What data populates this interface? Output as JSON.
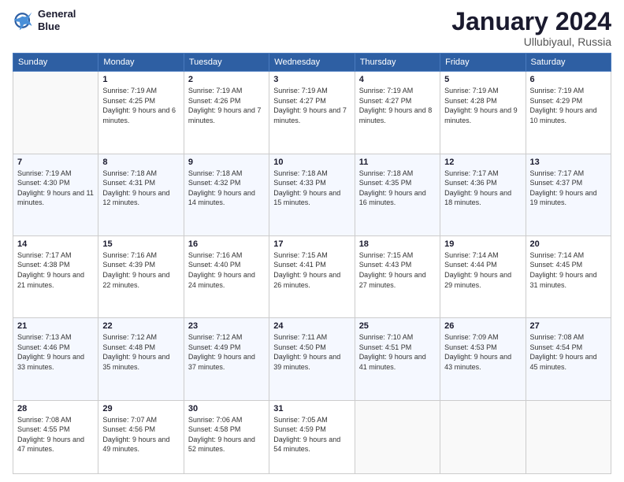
{
  "logo": {
    "line1": "General",
    "line2": "Blue"
  },
  "title": "January 2024",
  "location": "Ullubiyaul, Russia",
  "weekdays": [
    "Sunday",
    "Monday",
    "Tuesday",
    "Wednesday",
    "Thursday",
    "Friday",
    "Saturday"
  ],
  "weeks": [
    [
      {
        "day": "",
        "sunrise": "",
        "sunset": "",
        "daylight": ""
      },
      {
        "day": "1",
        "sunrise": "Sunrise: 7:19 AM",
        "sunset": "Sunset: 4:25 PM",
        "daylight": "Daylight: 9 hours and 6 minutes."
      },
      {
        "day": "2",
        "sunrise": "Sunrise: 7:19 AM",
        "sunset": "Sunset: 4:26 PM",
        "daylight": "Daylight: 9 hours and 7 minutes."
      },
      {
        "day": "3",
        "sunrise": "Sunrise: 7:19 AM",
        "sunset": "Sunset: 4:27 PM",
        "daylight": "Daylight: 9 hours and 7 minutes."
      },
      {
        "day": "4",
        "sunrise": "Sunrise: 7:19 AM",
        "sunset": "Sunset: 4:27 PM",
        "daylight": "Daylight: 9 hours and 8 minutes."
      },
      {
        "day": "5",
        "sunrise": "Sunrise: 7:19 AM",
        "sunset": "Sunset: 4:28 PM",
        "daylight": "Daylight: 9 hours and 9 minutes."
      },
      {
        "day": "6",
        "sunrise": "Sunrise: 7:19 AM",
        "sunset": "Sunset: 4:29 PM",
        "daylight": "Daylight: 9 hours and 10 minutes."
      }
    ],
    [
      {
        "day": "7",
        "sunrise": "Sunrise: 7:19 AM",
        "sunset": "Sunset: 4:30 PM",
        "daylight": "Daylight: 9 hours and 11 minutes."
      },
      {
        "day": "8",
        "sunrise": "Sunrise: 7:18 AM",
        "sunset": "Sunset: 4:31 PM",
        "daylight": "Daylight: 9 hours and 12 minutes."
      },
      {
        "day": "9",
        "sunrise": "Sunrise: 7:18 AM",
        "sunset": "Sunset: 4:32 PM",
        "daylight": "Daylight: 9 hours and 14 minutes."
      },
      {
        "day": "10",
        "sunrise": "Sunrise: 7:18 AM",
        "sunset": "Sunset: 4:33 PM",
        "daylight": "Daylight: 9 hours and 15 minutes."
      },
      {
        "day": "11",
        "sunrise": "Sunrise: 7:18 AM",
        "sunset": "Sunset: 4:35 PM",
        "daylight": "Daylight: 9 hours and 16 minutes."
      },
      {
        "day": "12",
        "sunrise": "Sunrise: 7:17 AM",
        "sunset": "Sunset: 4:36 PM",
        "daylight": "Daylight: 9 hours and 18 minutes."
      },
      {
        "day": "13",
        "sunrise": "Sunrise: 7:17 AM",
        "sunset": "Sunset: 4:37 PM",
        "daylight": "Daylight: 9 hours and 19 minutes."
      }
    ],
    [
      {
        "day": "14",
        "sunrise": "Sunrise: 7:17 AM",
        "sunset": "Sunset: 4:38 PM",
        "daylight": "Daylight: 9 hours and 21 minutes."
      },
      {
        "day": "15",
        "sunrise": "Sunrise: 7:16 AM",
        "sunset": "Sunset: 4:39 PM",
        "daylight": "Daylight: 9 hours and 22 minutes."
      },
      {
        "day": "16",
        "sunrise": "Sunrise: 7:16 AM",
        "sunset": "Sunset: 4:40 PM",
        "daylight": "Daylight: 9 hours and 24 minutes."
      },
      {
        "day": "17",
        "sunrise": "Sunrise: 7:15 AM",
        "sunset": "Sunset: 4:41 PM",
        "daylight": "Daylight: 9 hours and 26 minutes."
      },
      {
        "day": "18",
        "sunrise": "Sunrise: 7:15 AM",
        "sunset": "Sunset: 4:43 PM",
        "daylight": "Daylight: 9 hours and 27 minutes."
      },
      {
        "day": "19",
        "sunrise": "Sunrise: 7:14 AM",
        "sunset": "Sunset: 4:44 PM",
        "daylight": "Daylight: 9 hours and 29 minutes."
      },
      {
        "day": "20",
        "sunrise": "Sunrise: 7:14 AM",
        "sunset": "Sunset: 4:45 PM",
        "daylight": "Daylight: 9 hours and 31 minutes."
      }
    ],
    [
      {
        "day": "21",
        "sunrise": "Sunrise: 7:13 AM",
        "sunset": "Sunset: 4:46 PM",
        "daylight": "Daylight: 9 hours and 33 minutes."
      },
      {
        "day": "22",
        "sunrise": "Sunrise: 7:12 AM",
        "sunset": "Sunset: 4:48 PM",
        "daylight": "Daylight: 9 hours and 35 minutes."
      },
      {
        "day": "23",
        "sunrise": "Sunrise: 7:12 AM",
        "sunset": "Sunset: 4:49 PM",
        "daylight": "Daylight: 9 hours and 37 minutes."
      },
      {
        "day": "24",
        "sunrise": "Sunrise: 7:11 AM",
        "sunset": "Sunset: 4:50 PM",
        "daylight": "Daylight: 9 hours and 39 minutes."
      },
      {
        "day": "25",
        "sunrise": "Sunrise: 7:10 AM",
        "sunset": "Sunset: 4:51 PM",
        "daylight": "Daylight: 9 hours and 41 minutes."
      },
      {
        "day": "26",
        "sunrise": "Sunrise: 7:09 AM",
        "sunset": "Sunset: 4:53 PM",
        "daylight": "Daylight: 9 hours and 43 minutes."
      },
      {
        "day": "27",
        "sunrise": "Sunrise: 7:08 AM",
        "sunset": "Sunset: 4:54 PM",
        "daylight": "Daylight: 9 hours and 45 minutes."
      }
    ],
    [
      {
        "day": "28",
        "sunrise": "Sunrise: 7:08 AM",
        "sunset": "Sunset: 4:55 PM",
        "daylight": "Daylight: 9 hours and 47 minutes."
      },
      {
        "day": "29",
        "sunrise": "Sunrise: 7:07 AM",
        "sunset": "Sunset: 4:56 PM",
        "daylight": "Daylight: 9 hours and 49 minutes."
      },
      {
        "day": "30",
        "sunrise": "Sunrise: 7:06 AM",
        "sunset": "Sunset: 4:58 PM",
        "daylight": "Daylight: 9 hours and 52 minutes."
      },
      {
        "day": "31",
        "sunrise": "Sunrise: 7:05 AM",
        "sunset": "Sunset: 4:59 PM",
        "daylight": "Daylight: 9 hours and 54 minutes."
      },
      {
        "day": "",
        "sunrise": "",
        "sunset": "",
        "daylight": ""
      },
      {
        "day": "",
        "sunrise": "",
        "sunset": "",
        "daylight": ""
      },
      {
        "day": "",
        "sunrise": "",
        "sunset": "",
        "daylight": ""
      }
    ]
  ]
}
